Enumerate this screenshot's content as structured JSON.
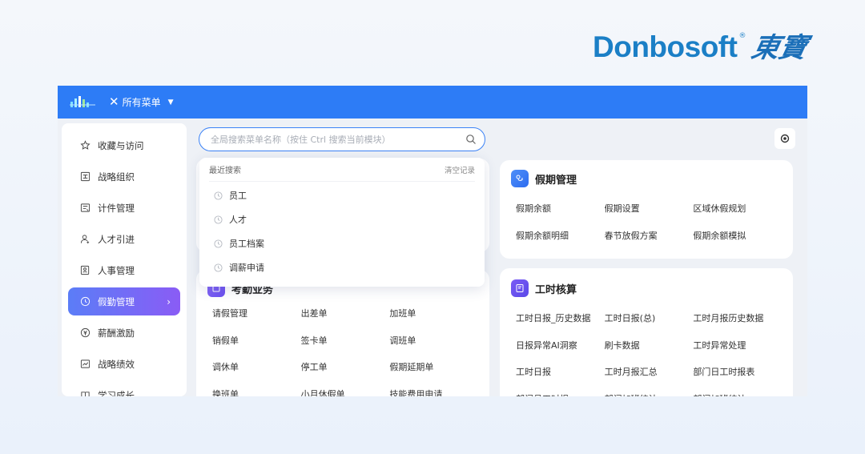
{
  "brand": {
    "name": "Donbosoft",
    "reg": "®",
    "cn": "東寶"
  },
  "topbar": {
    "menu_label": "所有菜单",
    "close_glyph": "✕",
    "caret_glyph": "▼"
  },
  "sidebar": {
    "items": [
      {
        "label": "收藏与访问",
        "icon": "star-icon"
      },
      {
        "label": "战略组织",
        "icon": "org-chart-icon"
      },
      {
        "label": "计件管理",
        "icon": "piecework-icon"
      },
      {
        "label": "人才引进",
        "icon": "user-add-icon"
      },
      {
        "label": "人事管理",
        "icon": "personnel-file-icon"
      },
      {
        "label": "假勤管理",
        "icon": "clock-icon",
        "active": true
      },
      {
        "label": "薪酬激励",
        "icon": "money-icon"
      },
      {
        "label": "战略绩效",
        "icon": "trend-chart-icon"
      },
      {
        "label": "学习成长",
        "icon": "book-icon"
      }
    ],
    "active_arrow": "›"
  },
  "search": {
    "placeholder": "全局搜索菜单名称（按住 Ctrl 搜索当前模块）",
    "value": ""
  },
  "dropdown": {
    "title": "最近搜索",
    "clear_label": "清空记录",
    "items": [
      "员工",
      "人才",
      "员工档案",
      "调薪申请"
    ]
  },
  "cards": {
    "kaoqin": {
      "title": "考勤业务",
      "items": [
        "请假管理",
        "出差单",
        "加班单",
        "销假单",
        "签卡单",
        "调班单",
        "调休单",
        "停工单",
        "假期延期单",
        "换班单",
        "小月休假单",
        "技能费用申请"
      ]
    },
    "jiaqi": {
      "title": "假期管理",
      "items": [
        "假期余额",
        "假期设置",
        "区域休假规划",
        "假期余额明细",
        "春节放假方案",
        "假期余额模拟"
      ]
    },
    "gongshi": {
      "title": "工时核算",
      "items": [
        "工时日报_历史数据",
        "工时日报(总)",
        "工时月报历史数据",
        "日报异常AI洞察",
        "刷卡数据",
        "工时异常处理",
        "工时日报",
        "工时月报汇总",
        "部门日工时报表",
        "部门月工时报",
        "部门加班统计",
        "部门加班统计"
      ]
    }
  },
  "colors": {
    "topbar": "#2d7cf6",
    "accent": "#3b82f6",
    "active_gradient_start": "#5b7df7",
    "active_gradient_end": "#8a5cf5",
    "brand": "#1b7fc6"
  }
}
